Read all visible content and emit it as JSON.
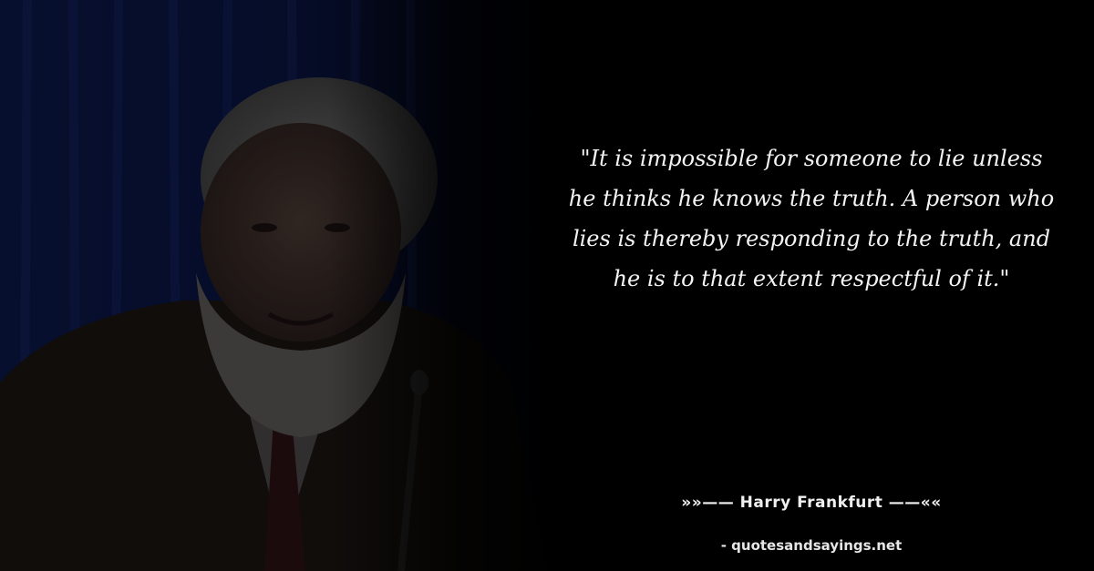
{
  "quote": {
    "text": "\"It is impossible for someone to lie unless he thinks he knows the truth. A person who lies is thereby responding to the truth, and he is to that extent respectful of it.\"",
    "author_line": "»»—— Harry Frankfurt ——««",
    "source_line": "- quotesandsayings.net"
  },
  "colors": {
    "background": "#000000",
    "text": "#f4f4f4",
    "curtain": "#0d1a4a"
  }
}
